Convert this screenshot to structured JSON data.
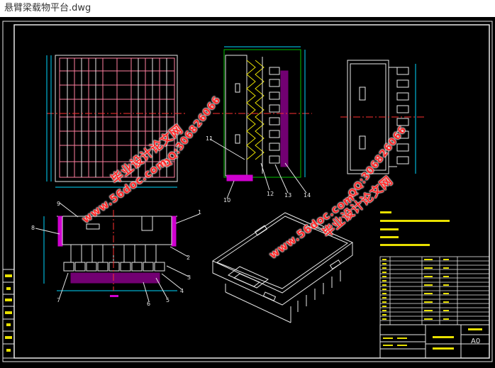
{
  "window": {
    "title": "悬臂梁载物平台.dwg"
  },
  "drawing": {
    "balloons": [
      "1",
      "2",
      "3",
      "4",
      "5",
      "6",
      "7",
      "8",
      "9",
      "10",
      "11",
      "12",
      "13",
      "14"
    ],
    "title_block": {
      "sheet_size": "A0"
    },
    "colors": {
      "background": "#000000",
      "white_lines": "#e8e8e8",
      "yellow_lines": "#e8e000",
      "pink_lines": "#ff7fa0",
      "magenta_hatch": "#d000d0",
      "green_frame": "#00c000",
      "red_centerline": "#ff3030",
      "cyan_dims": "#00d8ff"
    }
  },
  "watermarks": {
    "site": "www.56doc.com",
    "cn": "毕业设计论文网",
    "qq": "QQ:306826066"
  }
}
